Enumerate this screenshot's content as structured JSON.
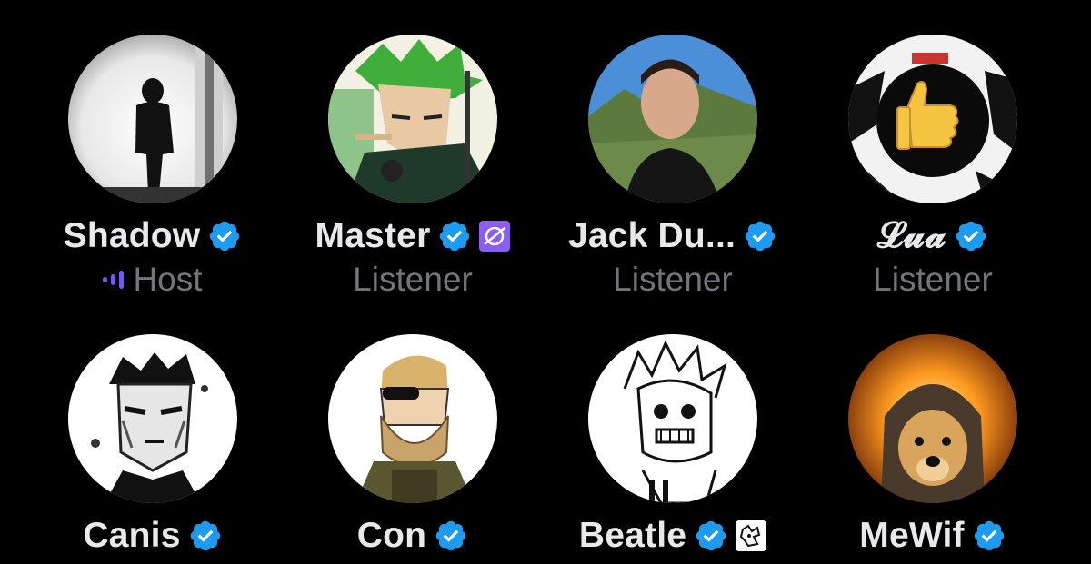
{
  "theme": {
    "background": "#000000",
    "name_color": "#e7e9ea",
    "role_color": "#71767b",
    "verified_color": "#1d9bf0",
    "speaking_color": "#7856ff"
  },
  "speakers": [
    {
      "name": "Shadow",
      "role": "Host",
      "verified": true,
      "speaking": true,
      "avatar": "silhouette-avatar"
    },
    {
      "name": "Master",
      "role": "Listener",
      "verified": true,
      "affiliate_badge": "purple-logo-badge",
      "avatar": "green-hair-anime-avatar"
    },
    {
      "name": "Jack Du...",
      "role": "Listener",
      "verified": true,
      "avatar": "man-photo-avatar"
    },
    {
      "name": "𝓛𝓾𝓪",
      "role": "Listener",
      "verified": true,
      "avatar": "thumbs-up-anime-avatar"
    },
    {
      "name": "Canis",
      "verified": true,
      "avatar": "black-white-man-avatar"
    },
    {
      "name": "Con",
      "verified": true,
      "avatar": "bearded-soldier-avatar"
    },
    {
      "name": "Beatle",
      "verified": true,
      "affiliate_badge": "sketch-logo-badge",
      "avatar": "sketch-face-avatar"
    },
    {
      "name": "MeWif",
      "verified": true,
      "avatar": "fire-dog-avatar"
    }
  ]
}
